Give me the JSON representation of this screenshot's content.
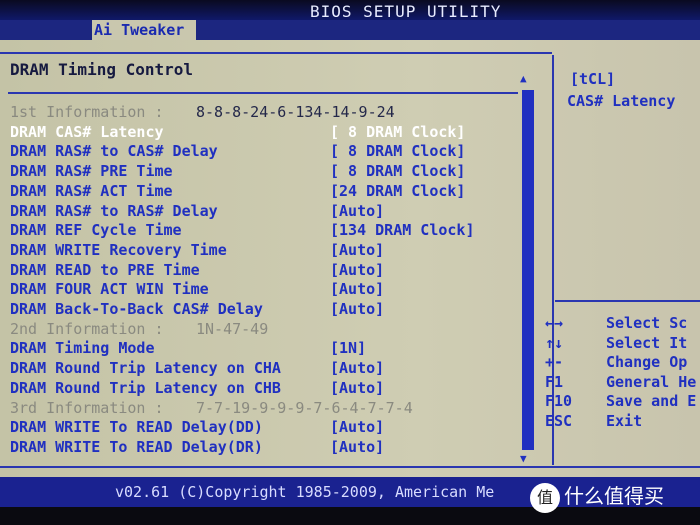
{
  "window": {
    "title": "BIOS SETUP UTILITY"
  },
  "tabs": [
    {
      "label": "Ai Tweaker",
      "active": true
    }
  ],
  "section": {
    "title": "DRAM Timing Control"
  },
  "items": [
    {
      "type": "info",
      "label": "1st Information :",
      "value": "8-8-8-24-6-134-14-9-24"
    },
    {
      "type": "setting",
      "label": "DRAM CAS# Latency",
      "value": "[ 8 DRAM Clock]",
      "selected": true
    },
    {
      "type": "setting",
      "label": "DRAM RAS# to CAS# Delay",
      "value": "[ 8 DRAM Clock]"
    },
    {
      "type": "setting",
      "label": "DRAM RAS# PRE Time",
      "value": "[ 8 DRAM Clock]"
    },
    {
      "type": "setting",
      "label": "DRAM RAS# ACT Time",
      "value": "[24 DRAM Clock]"
    },
    {
      "type": "setting",
      "label": "DRAM RAS# to RAS# Delay",
      "value": "[Auto]"
    },
    {
      "type": "setting",
      "label": "DRAM REF Cycle Time",
      "value": "[134 DRAM Clock]"
    },
    {
      "type": "setting",
      "label": "DRAM WRITE Recovery Time",
      "value": "[Auto]"
    },
    {
      "type": "setting",
      "label": "DRAM READ to PRE Time",
      "value": "[Auto]"
    },
    {
      "type": "setting",
      "label": "DRAM FOUR ACT WIN Time",
      "value": "[Auto]"
    },
    {
      "type": "setting",
      "label": "DRAM Back-To-Back CAS# Delay",
      "value": "[Auto]"
    },
    {
      "type": "info",
      "label": "2nd Information :",
      "value": "1N-47-49"
    },
    {
      "type": "setting",
      "label": "DRAM Timing Mode",
      "value": "[1N]"
    },
    {
      "type": "setting",
      "label": "DRAM Round Trip Latency on CHA",
      "value": "[Auto]"
    },
    {
      "type": "setting",
      "label": "DRAM Round Trip Latency on CHB",
      "value": "[Auto]"
    },
    {
      "type": "info",
      "label": "3rd Information :",
      "value": "7-7-19-9-9-9-7-6-4-7-7-4"
    },
    {
      "type": "setting",
      "label": "DRAM WRITE To READ Delay(DD)",
      "value": "[Auto]"
    },
    {
      "type": "setting",
      "label": "DRAM WRITE To READ Delay(DR)",
      "value": "[Auto]"
    }
  ],
  "help": {
    "key": "[tCL]",
    "description": "CAS# Latency"
  },
  "keys": [
    {
      "key": "←→",
      "action": "Select Sc"
    },
    {
      "key": "↑↓",
      "action": "Select It"
    },
    {
      "key": "+-",
      "action": "Change Op"
    },
    {
      "key": "F1",
      "action": "General He"
    },
    {
      "key": "F10",
      "action": "Save and E"
    },
    {
      "key": "ESC",
      "action": "Exit"
    }
  ],
  "footer": {
    "text": "v02.61 (C)Copyright 1985-2009, American Me"
  },
  "watermark": {
    "logo": "值",
    "text": "什么值得买"
  },
  "colors": {
    "text": "#2030c0",
    "selected": "#ffffff",
    "background": "#cfcdb3",
    "bar": "#1c2680"
  }
}
